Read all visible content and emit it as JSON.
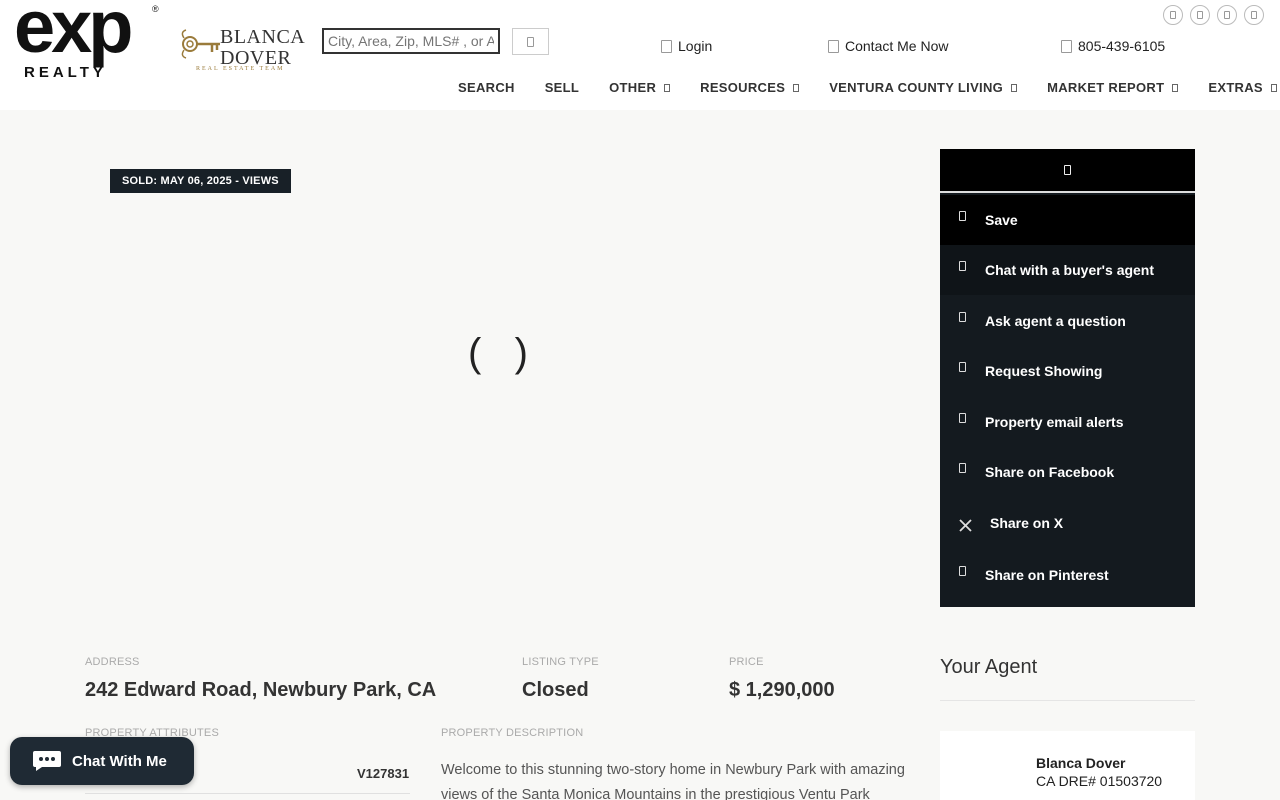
{
  "header": {
    "brand_mark": "exp",
    "brand_sub": "REALTY",
    "brand_reg": "®",
    "team_name_line1": "BLANCA",
    "team_name_line2": "DOVER",
    "team_tagline": "REAL ESTATE TEAM",
    "search_placeholder": "City, Area, Zip, MLS# , or Address",
    "login_label": "Login",
    "contact_label": "Contact Me Now",
    "phone_label": "805-439-6105",
    "social_icons": [
      "facebook-icon",
      "instagram-icon",
      "linkedin-icon",
      "youtube-icon"
    ]
  },
  "nav": {
    "items": [
      {
        "label": "SEARCH",
        "has_dropdown": false
      },
      {
        "label": "SELL",
        "has_dropdown": false
      },
      {
        "label": "OTHER",
        "has_dropdown": true
      },
      {
        "label": "RESOURCES",
        "has_dropdown": true
      },
      {
        "label": "VENTURA COUNTY LIVING",
        "has_dropdown": true
      },
      {
        "label": "MARKET REPORT",
        "has_dropdown": true
      },
      {
        "label": "EXTRAS",
        "has_dropdown": true
      }
    ]
  },
  "listing": {
    "sold_badge": "SOLD: MAY 06, 2025 - VIEWS",
    "address_label": "ADDRESS",
    "address": "242 Edward Road, Newbury Park, CA",
    "listing_type_label": "LISTING TYPE",
    "listing_type": "Closed",
    "price_label": "PRICE",
    "price": "$ 1,290,000",
    "attributes_label": "PROPERTY ATTRIBUTES",
    "mls_number": "V127831",
    "description_label": "PROPERTY DESCRIPTION",
    "description": "Welcome to this stunning two-story home in Newbury Park with amazing views of the Santa Monica Mountains in the prestigious Ventu Park"
  },
  "actions": {
    "items": [
      {
        "label": "Save",
        "icon": "heart-icon"
      },
      {
        "label": "Chat with a buyer's agent",
        "icon": "chat-icon"
      },
      {
        "label": "Ask agent a question",
        "icon": "question-icon"
      },
      {
        "label": "Request Showing",
        "icon": "calendar-icon"
      },
      {
        "label": "Property email alerts",
        "icon": "bell-icon"
      },
      {
        "label": "Share on Facebook",
        "icon": "facebook-icon"
      },
      {
        "label": "Share on X",
        "icon": "x-icon"
      },
      {
        "label": "Share on Pinterest",
        "icon": "pinterest-icon"
      }
    ]
  },
  "agent": {
    "section_title": "Your Agent",
    "name": "Blanca Dover",
    "license": "CA DRE# 01503720"
  },
  "chat": {
    "label": "Chat With Me"
  },
  "colors": {
    "panel_bg": "#141a1f",
    "badge_bg": "#182027",
    "chat_bg": "#1f2a34",
    "gold": "#9a7b3b"
  }
}
